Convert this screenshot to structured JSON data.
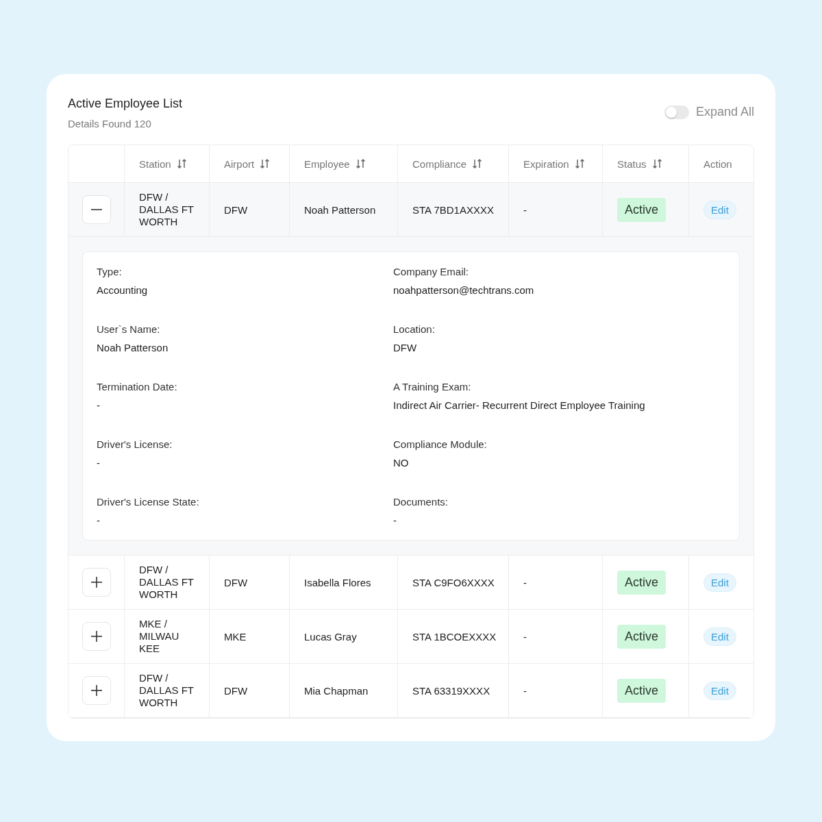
{
  "title": "Active Employee List",
  "subtitle": "Details Found 120",
  "expand_all": {
    "label": "Expand All",
    "on": false
  },
  "columns": [
    {
      "label": "Station",
      "sortable": true
    },
    {
      "label": "Airport",
      "sortable": true
    },
    {
      "label": "Employee",
      "sortable": true
    },
    {
      "label": "Compliance",
      "sortable": true
    },
    {
      "label": "Expiration",
      "sortable": true
    },
    {
      "label": "Status",
      "sortable": true
    },
    {
      "label": "Action",
      "sortable": false
    }
  ],
  "rows": [
    {
      "expanded": true,
      "station": [
        "DFW /",
        "DALLAS FT",
        "WORTH"
      ],
      "airport": "DFW",
      "employee": "Noah Patterson",
      "compliance": "STA 7BD1AXXXX",
      "expiration": "-",
      "status": "Active",
      "action": "Edit",
      "details": [
        {
          "label": "Type:",
          "value": "Accounting"
        },
        {
          "label": "Company Email:",
          "value": "noahpatterson@techtrans.com"
        },
        {
          "label": "User`s Name:",
          "value": "Noah Patterson"
        },
        {
          "label": "Location:",
          "value": "DFW"
        },
        {
          "label": "Termination Date:",
          "value": "-"
        },
        {
          "label": "A Training Exam:",
          "value": "Indirect Air Carrier- Recurrent Direct Employee Training"
        },
        {
          "label": "Driver's License:",
          "value": "-"
        },
        {
          "label": "Compliance Module:",
          "value": "NO"
        },
        {
          "label": "Driver's License State:",
          "value": "-"
        },
        {
          "label": "Documents:",
          "value": "-"
        }
      ]
    },
    {
      "expanded": false,
      "station": [
        "DFW /",
        "DALLAS FT",
        "WORTH"
      ],
      "airport": "DFW",
      "employee": "Isabella Flores",
      "compliance": "STA C9FO6XXXX",
      "expiration": "-",
      "status": "Active",
      "action": "Edit"
    },
    {
      "expanded": false,
      "station": [
        "MKE /",
        "MILWAU",
        "KEE"
      ],
      "airport": "MKE",
      "employee": "Lucas Gray",
      "compliance": "STA 1BCOEXXXX",
      "expiration": "-",
      "status": "Active",
      "action": "Edit"
    },
    {
      "expanded": false,
      "station": [
        "DFW /",
        "DALLAS FT",
        "WORTH"
      ],
      "airport": "DFW",
      "employee": "Mia Chapman",
      "compliance": "STA 63319XXXX",
      "expiration": "-",
      "status": "Active",
      "action": "Edit"
    }
  ]
}
